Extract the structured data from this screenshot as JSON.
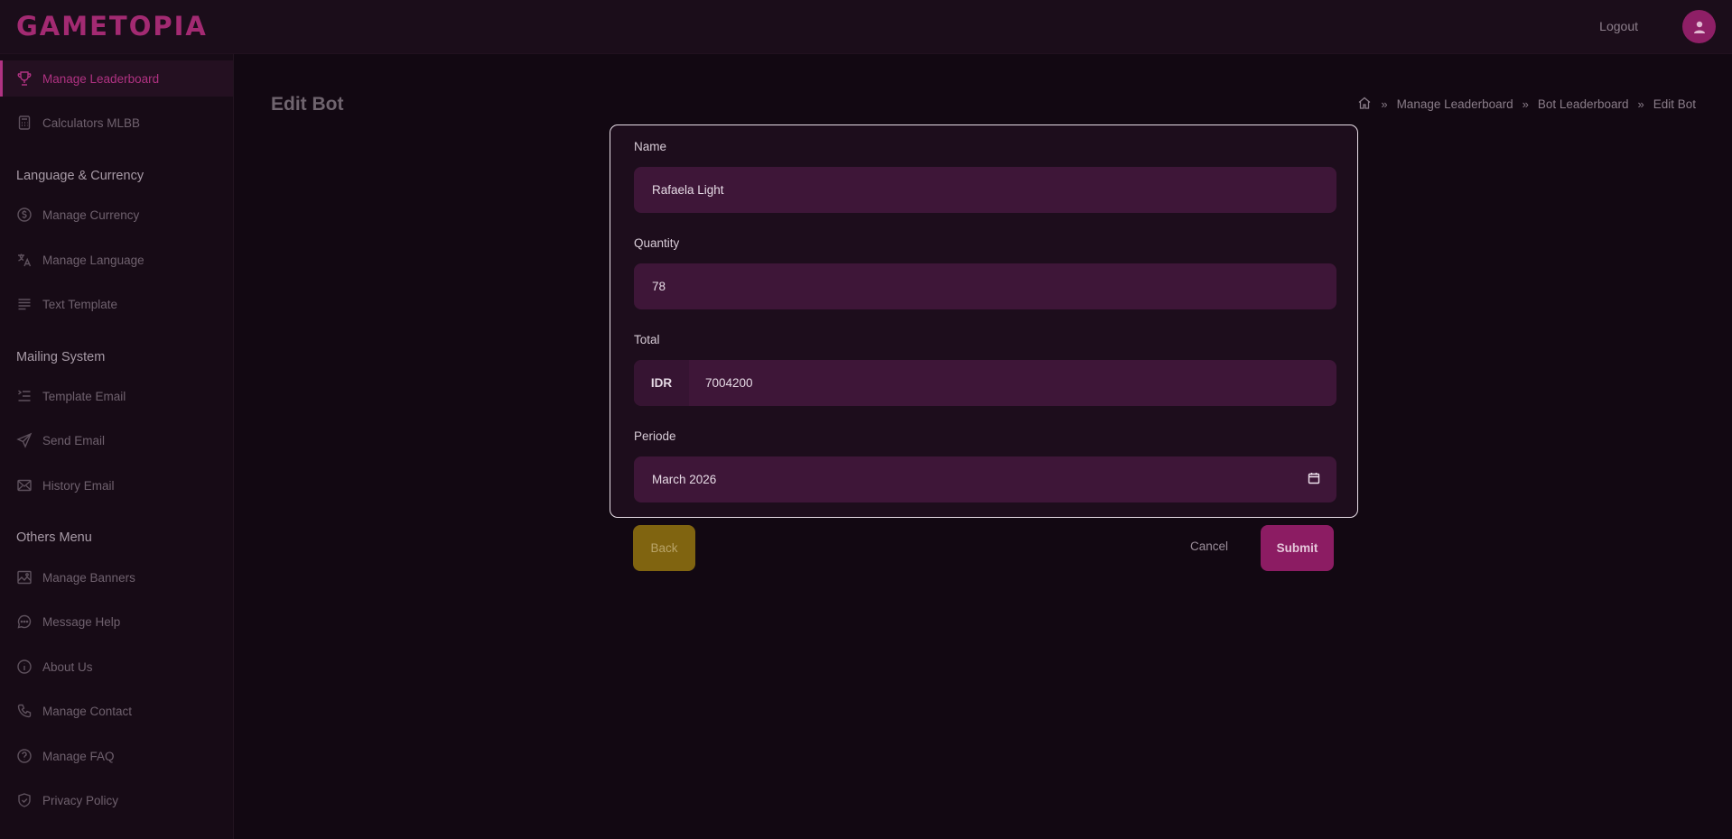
{
  "app": {
    "logo": "GAMETOPIA",
    "logout_label": "Logout"
  },
  "colors": {
    "accent": "#b03282",
    "background": "#120812",
    "back_button": "#806410",
    "submit_button": "#8c1c63"
  },
  "sidebar": {
    "items_top": [
      {
        "label": "Manage Leaderboard",
        "icon": "trophy-icon",
        "active": true
      },
      {
        "label": "Calculators MLBB",
        "icon": "calculator-icon"
      }
    ],
    "sections": [
      {
        "title": "Language & Currency",
        "items": [
          {
            "label": "Manage Currency",
            "icon": "dollar-circle-icon"
          },
          {
            "label": "Manage Language",
            "icon": "translate-icon"
          },
          {
            "label": "Text Template",
            "icon": "text-lines-icon"
          }
        ]
      },
      {
        "title": "Mailing System",
        "items": [
          {
            "label": "Template Email",
            "icon": "list-indent-icon"
          },
          {
            "label": "Send Email",
            "icon": "send-icon"
          },
          {
            "label": "History Email",
            "icon": "mail-icon"
          }
        ]
      },
      {
        "title": "Others Menu",
        "items": [
          {
            "label": "Manage Banners",
            "icon": "image-icon"
          },
          {
            "label": "Message Help",
            "icon": "chat-icon"
          },
          {
            "label": "About Us",
            "icon": "info-icon"
          },
          {
            "label": "Manage Contact",
            "icon": "phone-icon"
          },
          {
            "label": "Manage FAQ",
            "icon": "question-icon"
          },
          {
            "label": "Privacy Policy",
            "icon": "shield-icon"
          }
        ]
      }
    ]
  },
  "main": {
    "title": "Edit Bot",
    "breadcrumb": [
      "Manage Leaderboard",
      "Bot Leaderboard",
      "Edit Bot"
    ]
  },
  "form": {
    "name_label": "Name",
    "name_value": "Rafaela Light",
    "quantity_label": "Quantity",
    "quantity_value": "78",
    "total_label": "Total",
    "total_prefix": "IDR",
    "total_value": "7004200",
    "periode_label": "Periode",
    "periode_value": "March 2026"
  },
  "buttons": {
    "back": "Back",
    "cancel": "Cancel",
    "submit": "Submit"
  }
}
